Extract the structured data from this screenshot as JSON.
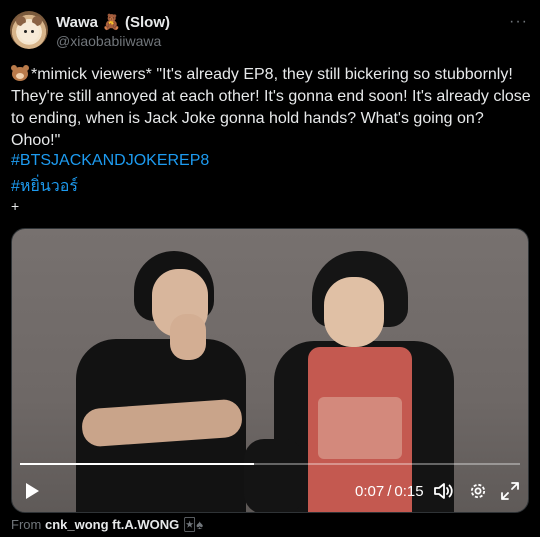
{
  "author": {
    "name": "Wawa",
    "name_emoji": "🧸",
    "name_suffix": "(Slow)",
    "handle": "@xiaobabiiwawa"
  },
  "menu": {
    "more_label": "···"
  },
  "tweet": {
    "text": "*mimick viewers* \"It's already EP8, they still bickering so stubbornly! They're still annoyed at each other! It's gonna end soon! It's already close to ending, when is Jack Joke gonna hold hands? What's going on? Ohoo!\"",
    "lead_emoji": "bear-face-icon",
    "hashtags": [
      "#BTSJACKANDJOKEREP8",
      "#หยิ่นวอร์"
    ],
    "plus": "+"
  },
  "video": {
    "current_time": "0:07",
    "separator": "/",
    "duration": "0:15",
    "progress": 0.467,
    "icons": [
      "play-icon",
      "volume-icon",
      "settings-gear-icon",
      "fullscreen-icon"
    ]
  },
  "attribution": {
    "from_label": "From",
    "source": "cnk_wong ft.A.WONG",
    "emojis": "🃏♠"
  },
  "colors": {
    "link": "#1d9bf0",
    "muted": "#71767b",
    "text": "#e7e9ea",
    "background": "#000000"
  }
}
